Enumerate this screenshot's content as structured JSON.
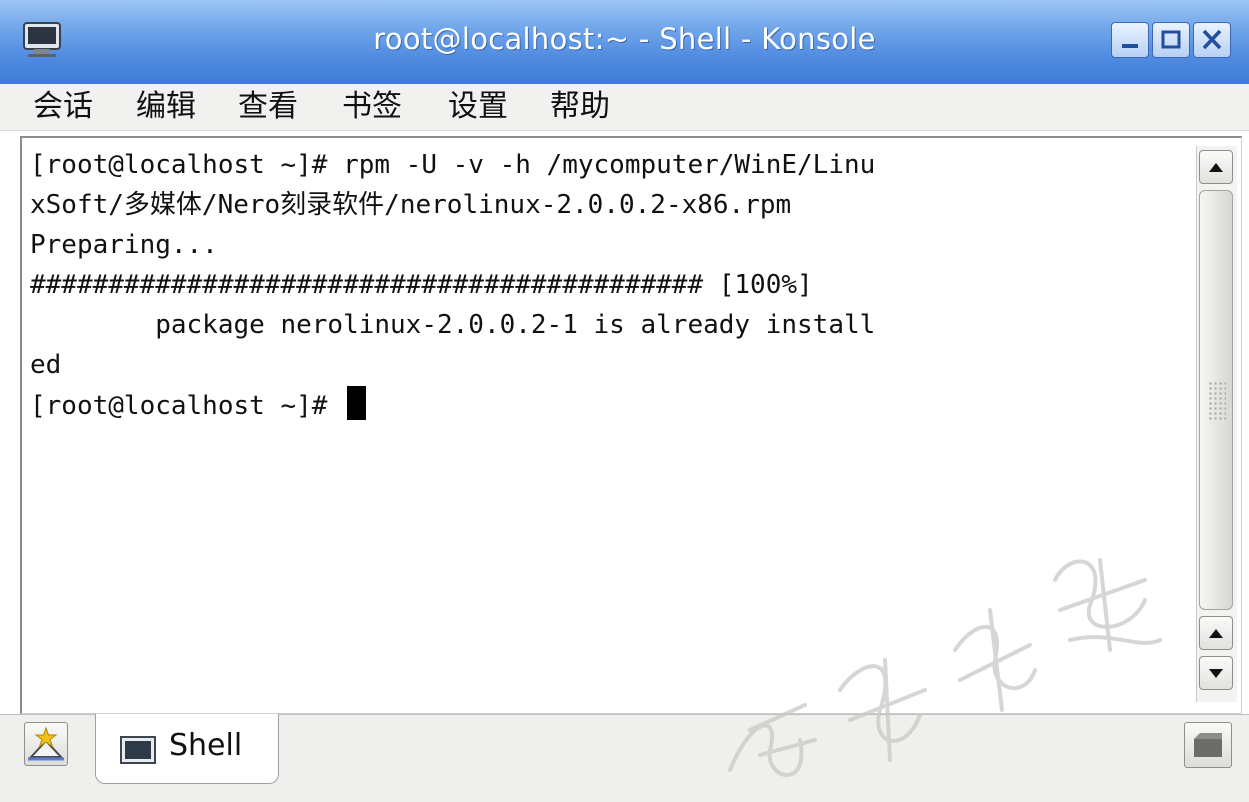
{
  "window": {
    "title": "root@localhost:~ - Shell - Konsole",
    "icon": "terminal-app-icon",
    "buttons": [
      "minimize",
      "maximize",
      "close"
    ]
  },
  "menu": {
    "items": [
      "会话",
      "编辑",
      "查看",
      "书签",
      "设置",
      "帮助"
    ]
  },
  "terminal": {
    "lines": [
      "[root@localhost ~]# rpm -U -v -h /mycomputer/WinE/Linu",
      "xSoft/多媒体/Nero刻录软件/nerolinux-2.0.0.2-x86.rpm",
      "Preparing...",
      "########################################### [100%]",
      "        package nerolinux-2.0.0.2-1 is already install",
      "ed",
      "[root@localhost ~]# "
    ]
  },
  "tabs": {
    "items": [
      {
        "label": "Shell",
        "icon": "terminal-icon",
        "active": true
      }
    ],
    "new_session_icon": "new-session-icon",
    "close_session_icon": "close-session-icon"
  },
  "colors": {
    "titlebar": "#4f8ae0",
    "terminal_bg": "#ffffff",
    "terminal_fg": "#111111"
  }
}
